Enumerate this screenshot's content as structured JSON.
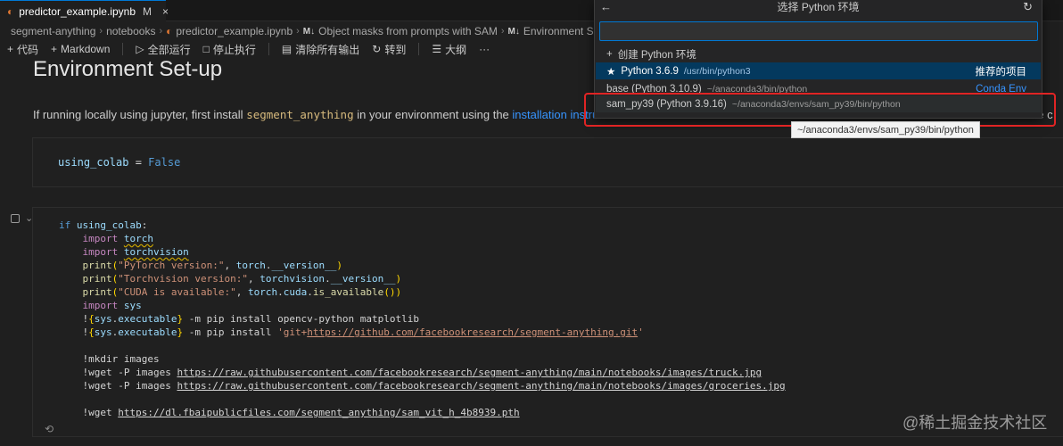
{
  "tab": {
    "filename": "predictor_example.ipynb",
    "modified": "M",
    "close": "×",
    "icon": "notebook-icon"
  },
  "breadcrumb": {
    "items": [
      "segment-anything",
      "notebooks",
      "predictor_example.ipynb",
      "Object masks from prompts with SAM",
      "Environment Set-u"
    ],
    "md_badge": "M↓"
  },
  "toolbar": {
    "code": "代码",
    "markdown": "Markdown",
    "run_all": "全部运行",
    "stop": "停止执行",
    "clear": "清除所有输出",
    "goto": "转到",
    "outline": "大纲",
    "more": "···"
  },
  "notebook": {
    "heading": "Environment Set-up",
    "para_prefix": "If running locally using jupyter, first install",
    "para_code": "segment_anything",
    "para_mid": "in your environment using the",
    "para_link": "installation instructio",
    "para_tail": "he c",
    "cell1": {
      "var": "using_colab",
      "op": " = ",
      "val": "False"
    }
  },
  "quickpick": {
    "title": "选择 Python 环境",
    "input_value": "",
    "create": "创建 Python 环境",
    "items": [
      {
        "name": "Python 3.6.9",
        "path": "/usr/bin/python3",
        "right": "推荐的项目"
      },
      {
        "name": "base (Python 3.10.9)",
        "path": "~/anaconda3/bin/python",
        "right": "Conda Env"
      },
      {
        "name": "sam_py39 (Python 3.9.16)",
        "path": "~/anaconda3/envs/sam_py39/bin/python",
        "right": ""
      }
    ],
    "tooltip": "~/anaconda3/envs/sam_py39/bin/python"
  },
  "watermark": "@稀土掘金技术社区",
  "colors": {
    "accent": "#0078d4",
    "highlight_box": "#e02424",
    "selection": "#04395e"
  }
}
